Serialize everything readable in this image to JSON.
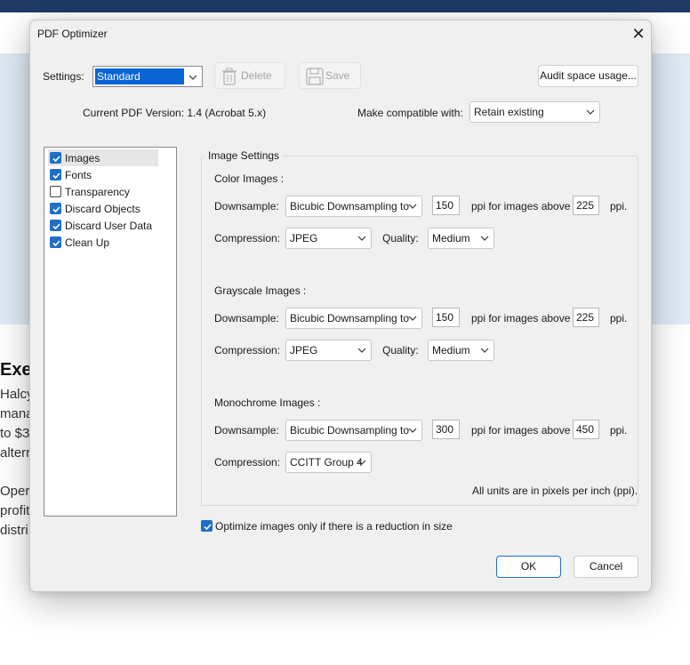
{
  "background": {
    "heading": "Exe",
    "lines": [
      "Halcy",
      "mana",
      "to $3",
      "alterr",
      "",
      "Oper",
      "profit",
      "distri"
    ]
  },
  "dialog": {
    "title": "PDF Optimizer",
    "settings_label": "Settings:",
    "settings_value": "Standard",
    "delete_label": "Delete",
    "save_label": "Save",
    "audit_label": "Audit space usage...",
    "version_text": "Current PDF Version: 1.4 (Acrobat 5.x)",
    "compat_label": "Make compatible with:",
    "compat_value": "Retain existing",
    "panels": [
      {
        "label": "Images",
        "checked": true,
        "selected": true
      },
      {
        "label": "Fonts",
        "checked": true,
        "selected": false
      },
      {
        "label": "Transparency",
        "checked": false,
        "selected": false
      },
      {
        "label": "Discard Objects",
        "checked": true,
        "selected": false
      },
      {
        "label": "Discard User Data",
        "checked": true,
        "selected": false
      },
      {
        "label": "Clean Up",
        "checked": true,
        "selected": false
      }
    ],
    "group_title": "Image Settings",
    "common": {
      "downsample_label": "Downsample:",
      "compression_label": "Compression:",
      "quality_label": "Quality:",
      "above_label": "ppi for images above",
      "ppi_label": "ppi."
    },
    "color": {
      "header": "Color Images :",
      "downsample": "Bicubic Downsampling to",
      "ppi": "150",
      "above": "225",
      "compression": "JPEG",
      "quality": "Medium"
    },
    "grayscale": {
      "header": "Grayscale Images :",
      "downsample": "Bicubic Downsampling to",
      "ppi": "150",
      "above": "225",
      "compression": "JPEG",
      "quality": "Medium"
    },
    "mono": {
      "header": "Monochrome Images :",
      "downsample": "Bicubic Downsampling to",
      "ppi": "300",
      "above": "450",
      "compression": "CCITT Group 4"
    },
    "units_note": "All units are in pixels per inch (ppi).",
    "optimize_label": "Optimize images only if there is a reduction in size",
    "optimize_checked": true,
    "ok_label": "OK",
    "cancel_label": "Cancel"
  },
  "colors": {
    "accent": "#1f6fc5",
    "selection": "#0a64d6",
    "band": "#dfeaf5",
    "topbar": "#1f3a66"
  }
}
